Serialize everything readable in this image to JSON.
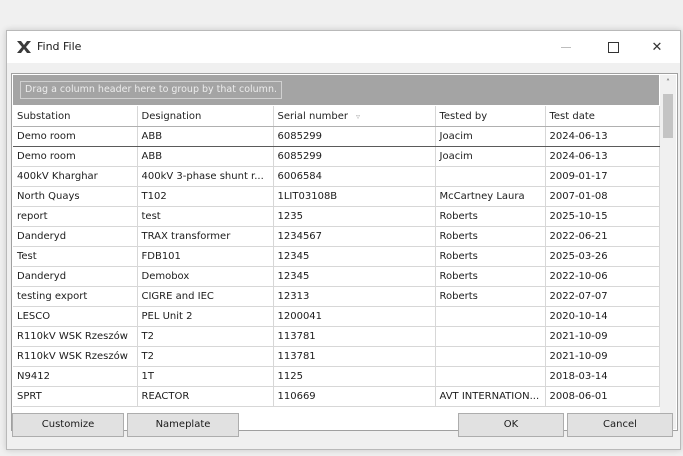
{
  "window": {
    "title": "Find File",
    "maximize_glyph": "",
    "close_glyph": "✕"
  },
  "group_panel": {
    "hint": "Drag a column header here to group by that column."
  },
  "table": {
    "columns": [
      "Substation",
      "Designation",
      "Serial number",
      "Tested by",
      "Test date"
    ],
    "sort_icon": "▿",
    "rows": [
      [
        "Demo room",
        "ABB",
        "6085299",
        "Joacim",
        "2024-06-13"
      ],
      [
        "Demo room",
        "ABB",
        "6085299",
        "Joacim",
        "2024-06-13"
      ],
      [
        "400kV Kharghar",
        "400kV 3-phase shunt r...",
        "6006584",
        "",
        "2009-01-17"
      ],
      [
        "North Quays",
        "T102",
        "1LIT03108B",
        "McCartney Laura",
        "2007-01-08"
      ],
      [
        "report",
        "test",
        "1235",
        "Roberts",
        "2025-10-15"
      ],
      [
        "Danderyd",
        "TRAX transformer",
        "1234567",
        "Roberts",
        "2022-06-21"
      ],
      [
        "Test",
        "FDB101",
        "12345",
        "Roberts",
        "2025-03-26"
      ],
      [
        "Danderyd",
        "Demobox",
        "12345",
        "Roberts",
        "2022-10-06"
      ],
      [
        "testing export",
        "CIGRE and IEC",
        "12313",
        "Roberts",
        "2022-07-07"
      ],
      [
        "LESCO",
        "PEL Unit 2",
        "1200041",
        "",
        "2020-10-14"
      ],
      [
        "R110kV WSK Rzeszów",
        "T2",
        "113781",
        "",
        "2021-10-09"
      ],
      [
        "R110kV WSK Rzeszów",
        "T2",
        "113781",
        "",
        "2021-10-09"
      ],
      [
        "N9412",
        "1T",
        "1125",
        "",
        "2018-03-14"
      ],
      [
        "SPRT",
        "REACTOR",
        "110669",
        "AVT INTERNATION...",
        "2008-06-01"
      ]
    ]
  },
  "scrollbar": {
    "up_glyph": "˄",
    "down_glyph": "˅"
  },
  "buttons": {
    "customize": "Customize",
    "nameplate": "Nameplate",
    "ok": "OK",
    "cancel": "Cancel"
  },
  "colors": {
    "app_icon": "#3a3a3a",
    "group_panel": "#a4a4a4"
  }
}
